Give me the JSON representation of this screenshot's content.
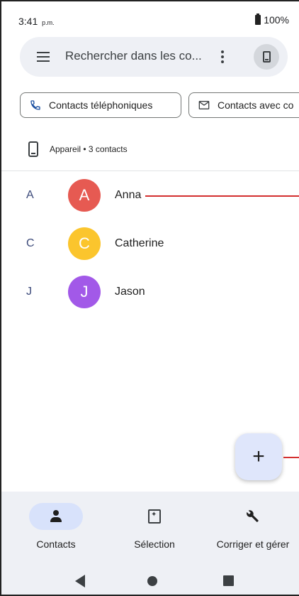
{
  "status_bar": {
    "time": "3:41",
    "time_suffix": "p.m.",
    "battery": "100%"
  },
  "search": {
    "placeholder": "Rechercher dans les co..."
  },
  "chips": [
    {
      "label": "Contacts téléphoniques",
      "icon": "phone-icon"
    },
    {
      "label": "Contacts avec co",
      "icon": "mail-icon"
    }
  ],
  "device": {
    "label": "Appareil • 3 contacts"
  },
  "contacts": [
    {
      "section": "A",
      "initial": "A",
      "name": "Anna",
      "color": "#e65a52"
    },
    {
      "section": "C",
      "initial": "C",
      "name": "Catherine",
      "color": "#fbc52d"
    },
    {
      "section": "J",
      "initial": "J",
      "name": "Jason",
      "color": "#a259e8"
    }
  ],
  "fab": {
    "label": "+"
  },
  "bottom_nav": [
    {
      "label": "Contacts",
      "icon": "person-icon",
      "active": true
    },
    {
      "label": "Sélection",
      "icon": "selection-icon",
      "active": false
    },
    {
      "label": "Corriger et gérer",
      "icon": "wrench-icon",
      "active": false
    }
  ],
  "colors": {
    "accent_bg": "#eef0f5",
    "active_pill": "#d8e2fb",
    "annotation_line": "#d32f2f"
  }
}
